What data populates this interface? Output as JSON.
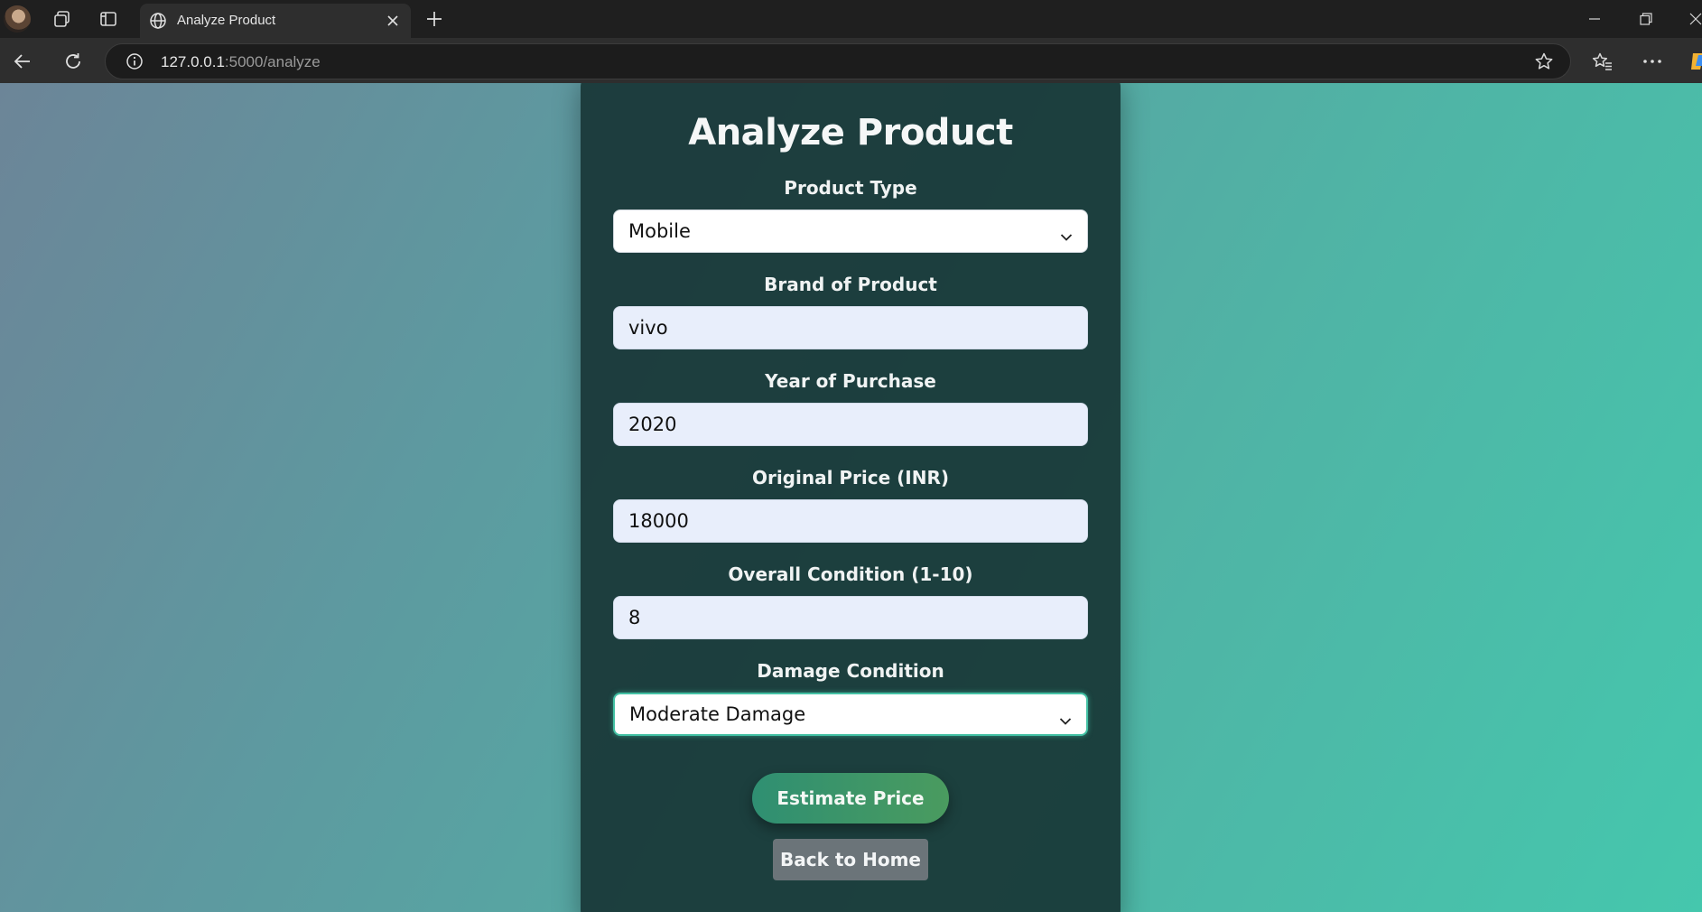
{
  "browser": {
    "tab_title": "Analyze Product",
    "url_host": "127.0.0.1",
    "url_rest": ":5000/analyze"
  },
  "page": {
    "title": "Analyze Product",
    "fields": {
      "product_type": {
        "label": "Product Type",
        "value": "Mobile"
      },
      "brand": {
        "label": "Brand of Product",
        "value": "vivo"
      },
      "year": {
        "label": "Year of Purchase",
        "value": "2020"
      },
      "price": {
        "label": "Original Price (INR)",
        "value": "18000"
      },
      "condition": {
        "label": "Overall Condition (1-10)",
        "value": "8"
      },
      "damage": {
        "label": "Damage Condition",
        "value": "Moderate Damage"
      }
    },
    "estimate_label": "Estimate Price",
    "home_label": "Back to Home"
  },
  "colors": {
    "card_bg": "#143030",
    "accent": "#43c1a4",
    "estimate_btn": "#2f8f72",
    "home_btn": "#6b7479"
  },
  "icons": [
    "profile-avatar",
    "workspaces-icon",
    "tab-actions-icon",
    "globe-icon",
    "close-icon",
    "plus-icon",
    "minimize-icon",
    "restore-icon",
    "back-icon",
    "refresh-icon",
    "info-icon",
    "star-icon",
    "favorites-icon",
    "more-icon",
    "chevron-down-icon"
  ]
}
